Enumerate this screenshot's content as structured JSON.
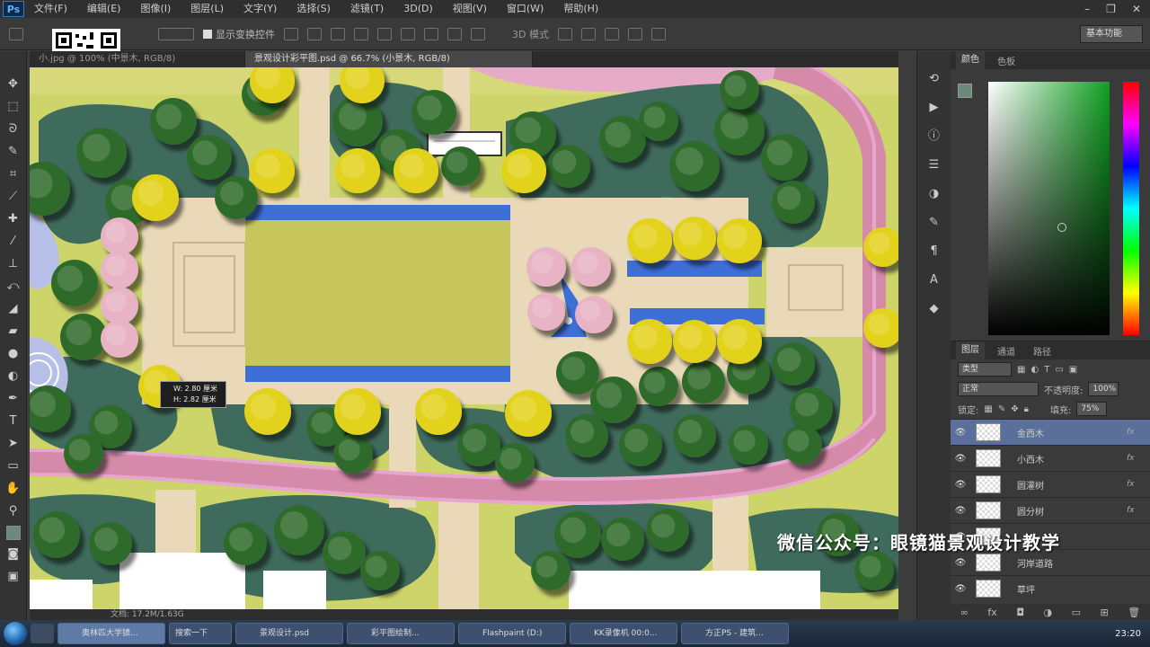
{
  "app": {
    "logo": "Ps"
  },
  "menu": {
    "items": [
      "文件(F)",
      "编辑(E)",
      "图像(I)",
      "图层(L)",
      "文字(Y)",
      "选择(S)",
      "滤镜(T)",
      "3D(D)",
      "视图(V)",
      "窗口(W)",
      "帮助(H)"
    ]
  },
  "options": {
    "transform_label": "显示变换控件",
    "mode_3d": "3D 模式",
    "workspace": "基本功能"
  },
  "doc": {
    "tabs": [
      "小.jpg @ 100% (中景木, RGB/8)",
      "景观设计彩平图.psd @ 66.7% (小景木, RGB/8)"
    ],
    "status": "文档: 17.2M/1.63G"
  },
  "measure": {
    "line1": "W: 2.80 厘米",
    "line2": "H: 2.82 厘米"
  },
  "color_panel": {
    "tab1": "颜色",
    "tab2": "色板"
  },
  "layers": {
    "tabs": [
      "图层",
      "通道",
      "路径"
    ],
    "kind_label": "类型",
    "blend_mode": "正常",
    "opacity_label": "不透明度:",
    "opacity_value": "100%",
    "lock_label": "锁定:",
    "fill_label": "填充:",
    "fill_value": "75%",
    "list": [
      {
        "name": "金西木",
        "fx": "fx",
        "selected": true
      },
      {
        "name": "小西木",
        "fx": "fx",
        "selected": false
      },
      {
        "name": "圆灌树",
        "fx": "fx",
        "selected": false
      },
      {
        "name": "圆分树",
        "fx": "fx",
        "selected": false
      },
      {
        "name": "",
        "fx": "",
        "selected": false
      },
      {
        "name": "河岸道路",
        "fx": "",
        "selected": false
      },
      {
        "name": "草坪",
        "fx": "",
        "selected": false
      }
    ]
  },
  "watermark": "微信公众号：眼镜猫景观设计教学",
  "taskbar": {
    "tasks": [
      "奥林匹大学镜...",
      "搜索一下",
      "景观设计.psd",
      "彩平图绘制...",
      "Flashpaint (D:)",
      "KK录像机 00:0...",
      "方正PS - 建筑..."
    ],
    "clock": "23:20"
  },
  "colors": {
    "accent": "#0fa020",
    "lawn": "#c6c65c",
    "water": "#3d6fd6",
    "paving": "#ead9b8",
    "path_pink": "#e38ec0",
    "tree_dark": "#2f6b2a",
    "tree_yellow": "#e3d21a",
    "tree_pink": "#e8b3c5",
    "shade_green": "#3f6b5c"
  }
}
